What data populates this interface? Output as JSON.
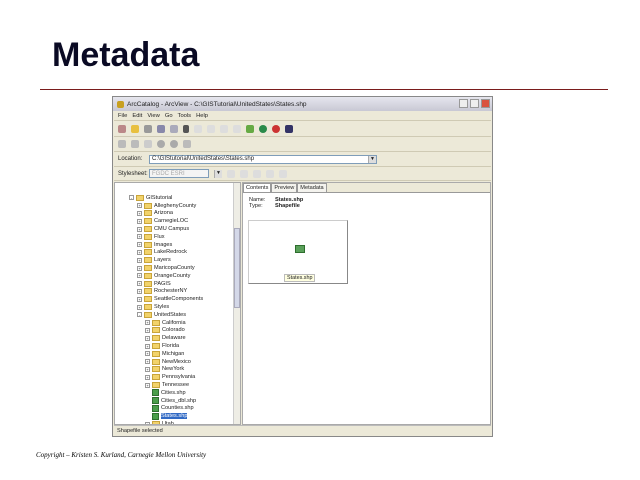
{
  "slide": {
    "title": "Metadata",
    "copyright": "Copyright – Kristen S. Kurland, Carnegie Mellon University"
  },
  "window": {
    "title": "ArcCatalog - ArcView - C:\\GISTutorial\\UnitedStates\\States.shp",
    "menu": [
      "File",
      "Edit",
      "View",
      "Go",
      "Tools",
      "Help"
    ],
    "location_label": "Location:",
    "location_value": "C:\\GIStutorial\\UnitedStates\\States.shp",
    "stylesheet_label": "Stylesheet:",
    "stylesheet_value": "FGDC ESRI",
    "tabs": [
      "Contents",
      "Preview",
      "Metadata"
    ],
    "contents": {
      "name_label": "Name:",
      "name_value": "States.shp",
      "type_label": "Type:",
      "type_value": "Shapefile",
      "thumb_caption": "States.shp"
    },
    "status": "Shapefile selected",
    "tree": [
      {
        "label": "GIStutorial",
        "level": 0,
        "type": "folder",
        "exp": "-"
      },
      {
        "label": "AlleghenyCounty",
        "level": 1,
        "type": "folder",
        "exp": "+"
      },
      {
        "label": "Arizona",
        "level": 1,
        "type": "folder",
        "exp": "+"
      },
      {
        "label": "CarnegieLOC",
        "level": 1,
        "type": "folder",
        "exp": "+"
      },
      {
        "label": "CMU Campus",
        "level": 1,
        "type": "folder",
        "exp": "+"
      },
      {
        "label": "Flux",
        "level": 1,
        "type": "folder",
        "exp": "+"
      },
      {
        "label": "Images",
        "level": 1,
        "type": "folder",
        "exp": "+"
      },
      {
        "label": "LakeRedrock",
        "level": 1,
        "type": "folder",
        "exp": "+"
      },
      {
        "label": "Layers",
        "level": 1,
        "type": "folder",
        "exp": "+"
      },
      {
        "label": "MaricopaCounty",
        "level": 1,
        "type": "folder",
        "exp": "+"
      },
      {
        "label": "OrangeCounty",
        "level": 1,
        "type": "folder",
        "exp": "+"
      },
      {
        "label": "PAGIS",
        "level": 1,
        "type": "folder",
        "exp": "+"
      },
      {
        "label": "RochesterNY",
        "level": 1,
        "type": "folder",
        "exp": "+"
      },
      {
        "label": "SeattleComponents",
        "level": 1,
        "type": "folder",
        "exp": "+"
      },
      {
        "label": "Styles",
        "level": 1,
        "type": "folder",
        "exp": "+"
      },
      {
        "label": "UnitedStates",
        "level": 1,
        "type": "folder",
        "exp": "-"
      },
      {
        "label": "California",
        "level": 2,
        "type": "folder",
        "exp": "+"
      },
      {
        "label": "Colorado",
        "level": 2,
        "type": "folder",
        "exp": "+"
      },
      {
        "label": "Delaware",
        "level": 2,
        "type": "folder",
        "exp": "+"
      },
      {
        "label": "Florida",
        "level": 2,
        "type": "folder",
        "exp": "+"
      },
      {
        "label": "Michigan",
        "level": 2,
        "type": "folder",
        "exp": "+"
      },
      {
        "label": "NewMexico",
        "level": 2,
        "type": "folder",
        "exp": "+"
      },
      {
        "label": "NewYork",
        "level": 2,
        "type": "folder",
        "exp": "+"
      },
      {
        "label": "Pennsylvania",
        "level": 2,
        "type": "folder",
        "exp": "+"
      },
      {
        "label": "Tennessee",
        "level": 2,
        "type": "folder",
        "exp": "+"
      },
      {
        "label": "Cities.shp",
        "level": 2,
        "type": "shp",
        "exp": ""
      },
      {
        "label": "Cities_dbl.shp",
        "level": 2,
        "type": "shp",
        "exp": ""
      },
      {
        "label": "Counties.shp",
        "level": 2,
        "type": "shp",
        "exp": ""
      },
      {
        "label": "States.shp",
        "level": 2,
        "type": "shp",
        "exp": "",
        "selected": true
      },
      {
        "label": "Utah",
        "level": 2,
        "type": "folder",
        "exp": "+"
      }
    ]
  }
}
